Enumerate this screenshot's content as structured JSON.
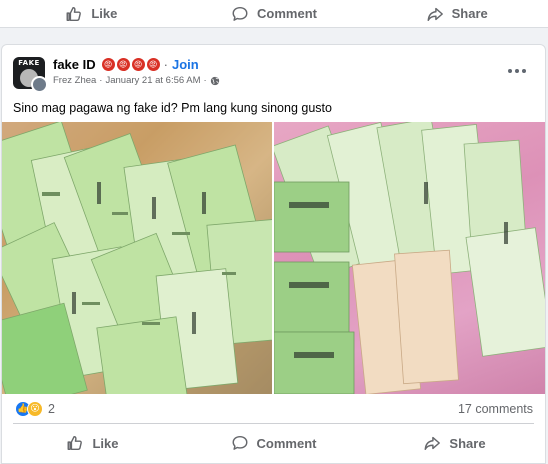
{
  "top_actions": {
    "like_label": "Like",
    "comment_label": "Comment",
    "share_label": "Share"
  },
  "post": {
    "group_avatar_text": "FAKE",
    "group_name": "fake ID",
    "emojis": [
      "😡",
      "😡",
      "😡",
      "😡"
    ],
    "separator": "·",
    "join_label": "Join",
    "author": "Frez Zhea",
    "separator2": "·",
    "timestamp": "January 21 at 6:56 AM",
    "separator3": "·",
    "text": "Sino mag pagawa ng fake id? Pm lang kung sinong gusto",
    "reaction_count": "2",
    "comment_count": "17 comments",
    "actions": {
      "like_label": "Like",
      "comment_label": "Comment",
      "share_label": "Share"
    }
  },
  "colors": {
    "accent": "#1b74e4",
    "like_blue": "#1877f2",
    "wow_yellow": "#f7b928",
    "secondary_text": "#65676b"
  },
  "icons": [
    "like-icon",
    "comment-icon",
    "share-icon",
    "globe-icon",
    "more-icon",
    "like-reaction-icon",
    "wow-reaction-icon"
  ]
}
